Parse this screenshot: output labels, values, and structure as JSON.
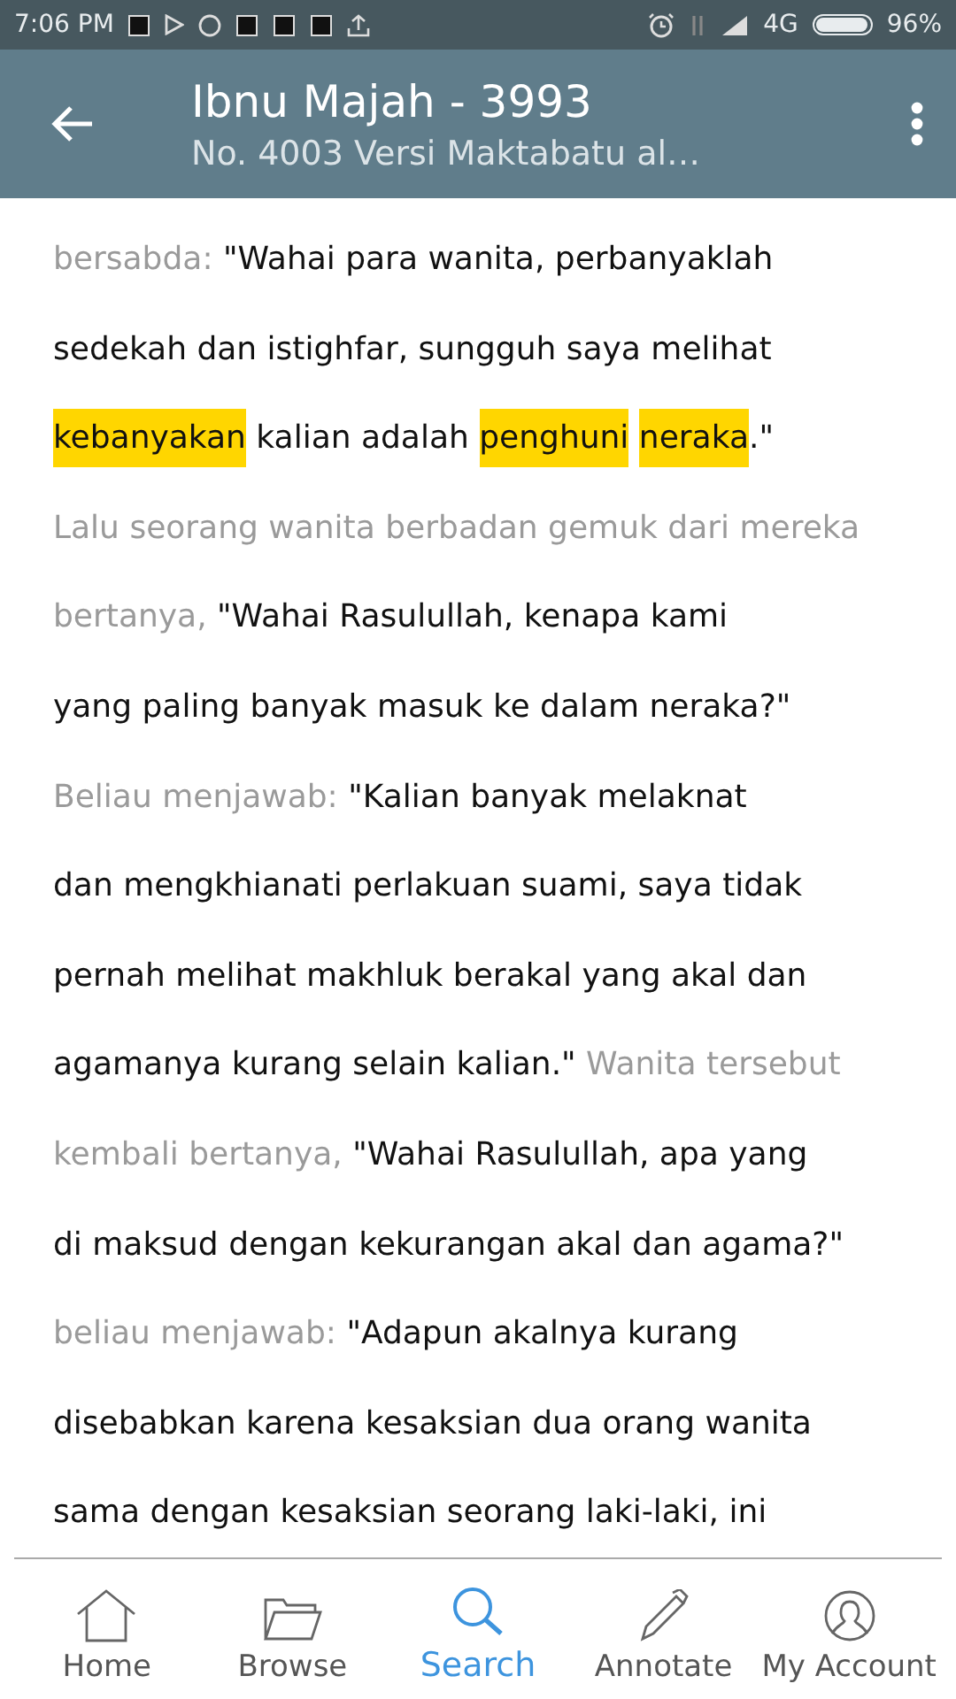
{
  "status_bar": {
    "time": "7:06 PM",
    "network": "4G",
    "battery": "96%"
  },
  "toolbar": {
    "title": "Ibnu Majah - 3993",
    "subtitle": "No. 4003 Versi Maktabatu al…"
  },
  "lines": [
    [
      {
        "kind": "narration",
        "text": "bersabda: "
      },
      {
        "kind": "speech",
        "text": "\"Wahai para wanita, perbanyaklah"
      }
    ],
    [
      {
        "kind": "speech",
        "text": "sedekah dan istighfar, sungguh saya melihat"
      }
    ],
    [
      {
        "kind": "highlight",
        "text": "kebanyakan"
      },
      {
        "kind": "speech",
        "text": " kalian adalah "
      },
      {
        "kind": "highlight",
        "text": "penghuni",
        "space_after": true
      },
      {
        "kind": "highlight",
        "text": "neraka"
      },
      {
        "kind": "speech",
        "text": ".\""
      }
    ],
    [
      {
        "kind": "narration",
        "text": "Lalu seorang wanita berbadan gemuk dari mereka"
      }
    ],
    [
      {
        "kind": "narration",
        "text": "bertanya, "
      },
      {
        "kind": "speech",
        "text": "\"Wahai Rasulullah, kenapa kami"
      }
    ],
    [
      {
        "kind": "speech",
        "text": "yang paling banyak masuk ke dalam neraka?\""
      }
    ],
    [
      {
        "kind": "narration",
        "text": "Beliau menjawab: "
      },
      {
        "kind": "speech",
        "text": "\"Kalian banyak melaknat"
      }
    ],
    [
      {
        "kind": "speech",
        "text": "dan mengkhianati perlakuan suami, saya tidak"
      }
    ],
    [
      {
        "kind": "speech",
        "text": "pernah melihat makhluk berakal yang akal dan"
      }
    ],
    [
      {
        "kind": "speech",
        "text": "agamanya kurang selain kalian.\" "
      },
      {
        "kind": "narration",
        "text": "Wanita tersebut"
      }
    ],
    [
      {
        "kind": "narration",
        "text": "kembali bertanya, "
      },
      {
        "kind": "speech",
        "text": "\"Wahai Rasulullah, apa yang"
      }
    ],
    [
      {
        "kind": "speech",
        "text": "di maksud dengan kekurangan akal dan agama?\""
      }
    ],
    [
      {
        "kind": "narration",
        "text": "beliau menjawab: "
      },
      {
        "kind": "speech",
        "text": "\"Adapun akalnya kurang"
      }
    ],
    [
      {
        "kind": "speech",
        "text": "disebabkan karena kesaksian dua orang wanita"
      }
    ],
    [
      {
        "kind": "speech",
        "text": "sama dengan kesaksian seorang laki-laki, ini"
      }
    ]
  ],
  "tabs": [
    {
      "kind": "home",
      "label": "Home",
      "selected": false
    },
    {
      "kind": "browse",
      "label": "Browse",
      "selected": false
    },
    {
      "kind": "search",
      "label": "Search",
      "selected": true
    },
    {
      "kind": "annotate",
      "label": "Annotate",
      "selected": false
    },
    {
      "kind": "account",
      "label": "My Account",
      "selected": false
    }
  ]
}
